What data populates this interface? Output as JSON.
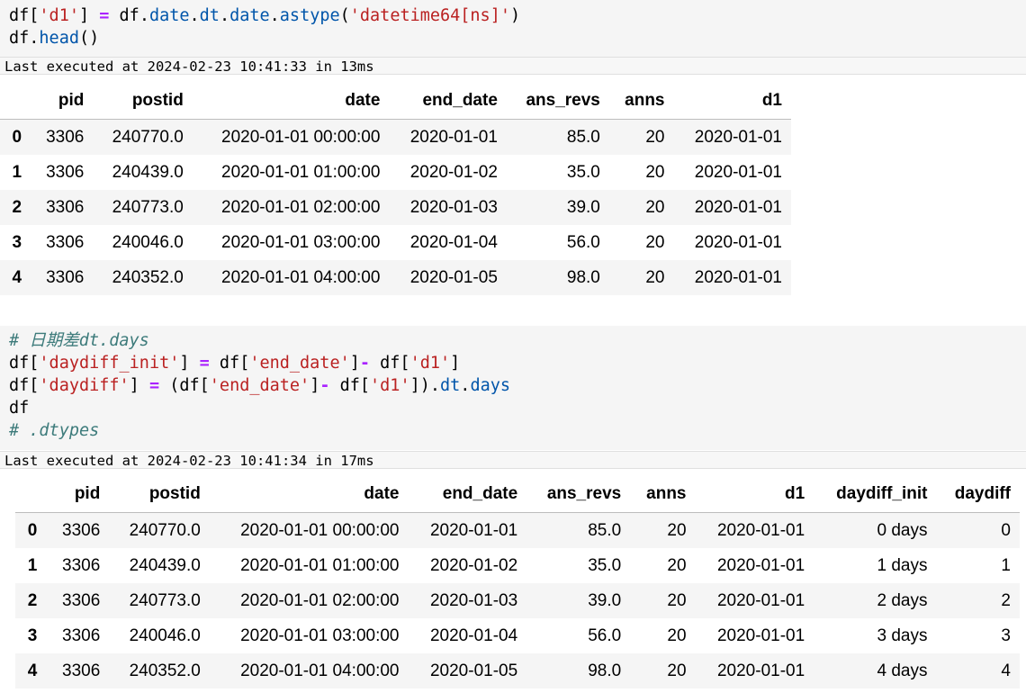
{
  "cell1": {
    "exec_text": "Last executed at 2024-02-23 10:41:33 in 13ms"
  },
  "table1": {
    "columns": [
      "",
      "pid",
      "postid",
      "date",
      "end_date",
      "ans_revs",
      "anns",
      "d1"
    ],
    "rows": [
      [
        "0",
        "3306",
        "240770.0",
        "2020-01-01 00:00:00",
        "2020-01-01",
        "85.0",
        "20",
        "2020-01-01"
      ],
      [
        "1",
        "3306",
        "240439.0",
        "2020-01-01 01:00:00",
        "2020-01-02",
        "35.0",
        "20",
        "2020-01-01"
      ],
      [
        "2",
        "3306",
        "240773.0",
        "2020-01-01 02:00:00",
        "2020-01-03",
        "39.0",
        "20",
        "2020-01-01"
      ],
      [
        "3",
        "3306",
        "240046.0",
        "2020-01-01 03:00:00",
        "2020-01-04",
        "56.0",
        "20",
        "2020-01-01"
      ],
      [
        "4",
        "3306",
        "240352.0",
        "2020-01-01 04:00:00",
        "2020-01-05",
        "98.0",
        "20",
        "2020-01-01"
      ]
    ]
  },
  "cell2": {
    "exec_text": "Last executed at 2024-02-23 10:41:34 in 17ms"
  },
  "table2": {
    "columns": [
      "",
      "pid",
      "postid",
      "date",
      "end_date",
      "ans_revs",
      "anns",
      "d1",
      "daydiff_init",
      "daydiff"
    ],
    "rows": [
      [
        "0",
        "3306",
        "240770.0",
        "2020-01-01 00:00:00",
        "2020-01-01",
        "85.0",
        "20",
        "2020-01-01",
        "0 days",
        "0"
      ],
      [
        "1",
        "3306",
        "240439.0",
        "2020-01-01 01:00:00",
        "2020-01-02",
        "35.0",
        "20",
        "2020-01-01",
        "1 days",
        "1"
      ],
      [
        "2",
        "3306",
        "240773.0",
        "2020-01-01 02:00:00",
        "2020-01-03",
        "39.0",
        "20",
        "2020-01-01",
        "2 days",
        "2"
      ],
      [
        "3",
        "3306",
        "240046.0",
        "2020-01-01 03:00:00",
        "2020-01-04",
        "56.0",
        "20",
        "2020-01-01",
        "3 days",
        "3"
      ],
      [
        "4",
        "3306",
        "240352.0",
        "2020-01-01 04:00:00",
        "2020-01-05",
        "98.0",
        "20",
        "2020-01-01",
        "4 days",
        "4"
      ]
    ]
  }
}
